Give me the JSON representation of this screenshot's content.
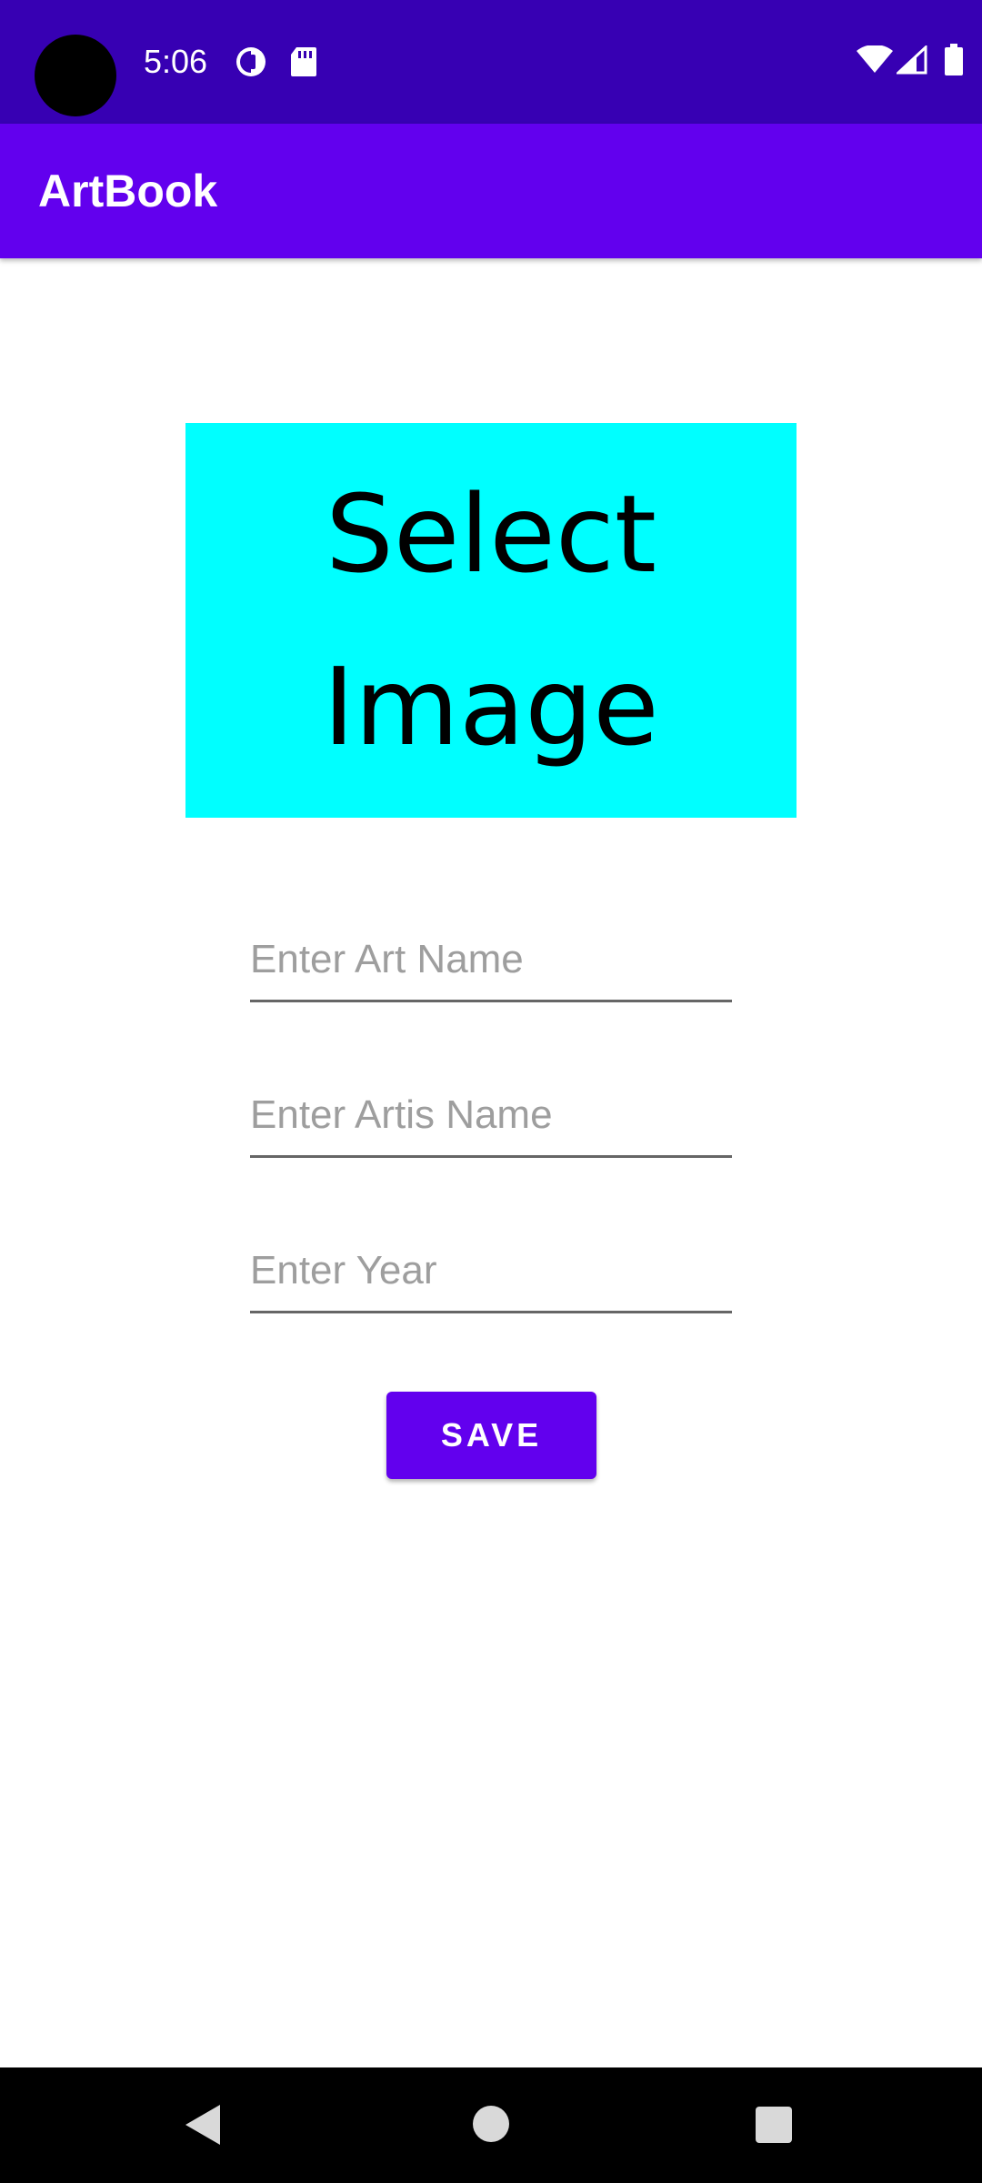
{
  "status_bar": {
    "time": "5:06",
    "icons": [
      "sync-icon",
      "sd-card-icon",
      "wifi-icon",
      "signal-icon",
      "battery-icon"
    ]
  },
  "app_bar": {
    "title": "ArtBook",
    "color": "#6200ee"
  },
  "select_image": {
    "line1": "Select",
    "line2": "Image",
    "background": "#00ffff"
  },
  "form": {
    "art_name": {
      "value": "",
      "placeholder": "Enter Art Name"
    },
    "artist_name": {
      "value": "",
      "placeholder": "Enter Artis Name"
    },
    "year": {
      "value": "",
      "placeholder": "Enter Year"
    },
    "save_label": "SAVE"
  },
  "navigation": {
    "icons": [
      "back-icon",
      "home-icon",
      "recents-icon"
    ]
  },
  "colors": {
    "status_bar": "#3700b3",
    "primary": "#6200ee",
    "accent_image": "#00ffff"
  }
}
